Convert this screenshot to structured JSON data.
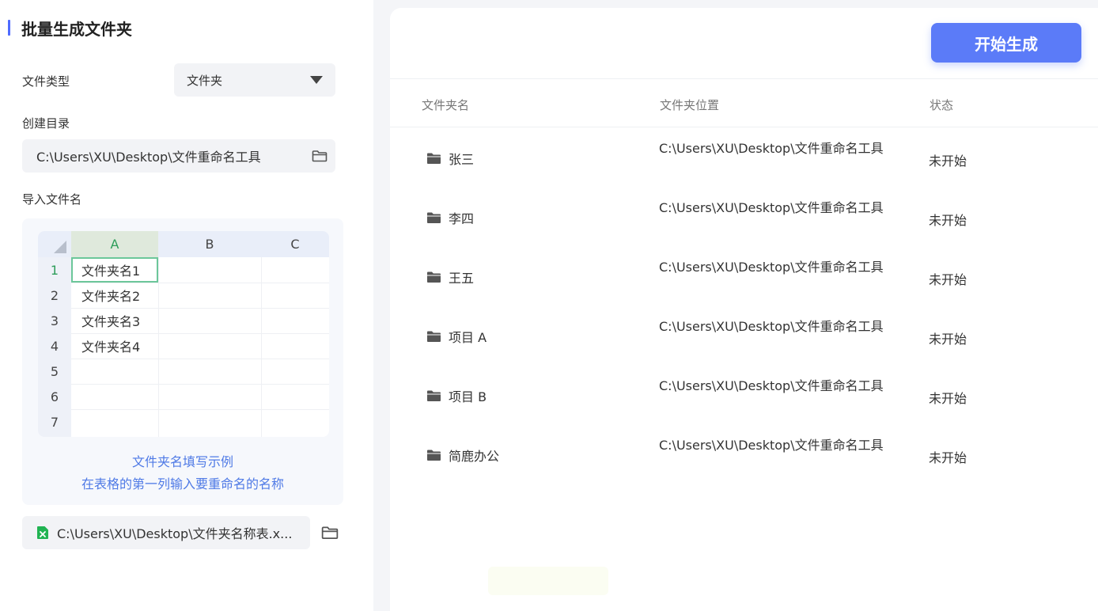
{
  "left": {
    "title": "批量生成文件夹",
    "file_type_label": "文件类型",
    "file_type_value": "文件夹",
    "create_dir_label": "创建目录",
    "create_dir_value": "C:\\Users\\XU\\Desktop\\文件重命名工具",
    "import_label": "导入文件名",
    "sheet": {
      "columns": [
        "A",
        "B",
        "C"
      ],
      "rows": [
        "1",
        "2",
        "3",
        "4",
        "5",
        "6",
        "7"
      ],
      "cells": [
        "文件夹名1",
        "文件夹名2",
        "文件夹名3",
        "文件夹名4"
      ]
    },
    "caption_line1": "文件夹名填写示例",
    "caption_line2": "在表格的第一列输入要重命名的名称",
    "import_file_value": "C:\\Users\\XU\\Desktop\\文件夹名称表.x..."
  },
  "right": {
    "start_button": "开始生成",
    "headers": {
      "name": "文件夹名",
      "location": "文件夹位置",
      "status": "状态"
    },
    "rows": [
      {
        "name": "张三",
        "location": "C:\\Users\\XU\\Desktop\\文件重命名工具",
        "status": "未开始"
      },
      {
        "name": "李四",
        "location": "C:\\Users\\XU\\Desktop\\文件重命名工具",
        "status": "未开始"
      },
      {
        "name": "王五",
        "location": "C:\\Users\\XU\\Desktop\\文件重命名工具",
        "status": "未开始"
      },
      {
        "name": "项目 A",
        "location": "C:\\Users\\XU\\Desktop\\文件重命名工具",
        "status": "未开始"
      },
      {
        "name": "项目 B",
        "location": "C:\\Users\\XU\\Desktop\\文件重命名工具",
        "status": "未开始"
      },
      {
        "name": "简鹿办公",
        "location": "C:\\Users\\XU\\Desktop\\文件重命名工具",
        "status": "未开始"
      }
    ]
  },
  "icons": {
    "folder": "folder-icon",
    "folder_outline": "folder-open-icon",
    "excel": "excel-file-icon",
    "caret": "caret-down-icon"
  },
  "colors": {
    "accent": "#5b7bf8",
    "caption": "#4f7ae6",
    "excel_green": "#21b352",
    "active_col": "#2e9d5a"
  }
}
